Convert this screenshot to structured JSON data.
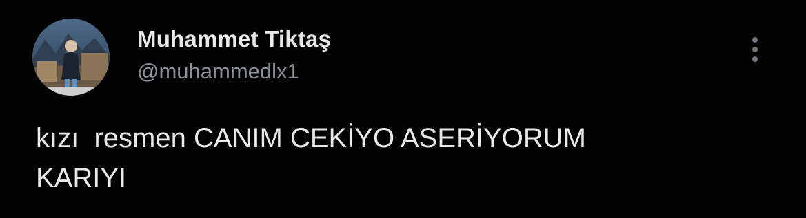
{
  "author": {
    "display_name": "Muhammet Tiktaş",
    "handle": "@muhammedlx1",
    "avatar_icon": "user-photo-avatar"
  },
  "tweet": {
    "text": "kızı  resmen CANIM CEKİYO ASERİYORUM\nKARIYI"
  },
  "actions": {
    "more_icon": "more-vertical-icon"
  },
  "colors": {
    "background": "#000000",
    "text_primary": "#e7e9ea",
    "text_secondary": "#8b9097",
    "icon": "#71767b"
  }
}
